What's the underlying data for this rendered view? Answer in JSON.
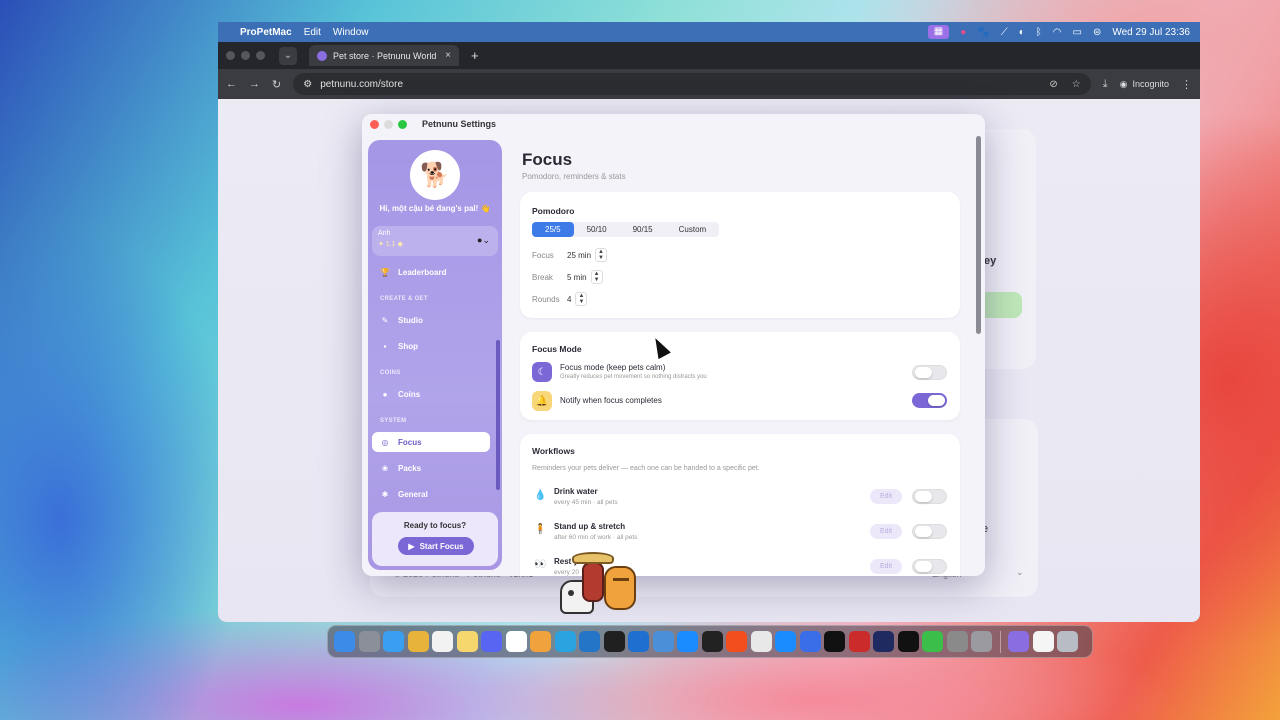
{
  "menubar": {
    "app_name": "ProPetMac",
    "menus": [
      "Edit",
      "Window"
    ],
    "datetime": "Wed 29 Jul  23:36"
  },
  "browser": {
    "tab_title": "Pet store · Petnunu World",
    "url": "petnunu.com/store",
    "incognito_label": "Incognito"
  },
  "background_page": {
    "partial_text_1": "ey",
    "partial_btn": "nd",
    "partial_text_2": "e",
    "footer_left": "© 2026 Petnunu · Petnuno · v1.0.1",
    "footer_lang": "English"
  },
  "settings": {
    "window_title": "Petnunu Settings",
    "sidebar": {
      "greeting": "Hi, một cậu bé đang's pal! 👋",
      "user_name": "Anh",
      "user_stats": "✦ 1.1 ◆",
      "items": {
        "leaderboard": "Leaderboard",
        "section_create": "CREATE & GET",
        "studio": "Studio",
        "shop": "Shop",
        "section_coins": "COINS",
        "coins": "Coins",
        "section_system": "SYSTEM",
        "focus": "Focus",
        "packs": "Packs",
        "general": "General"
      },
      "cta": {
        "question": "Ready to focus?",
        "button": "Start Focus"
      }
    },
    "page": {
      "title": "Focus",
      "subtitle": "Pomodoro, reminders & stats"
    },
    "pomodoro": {
      "header": "Pomodoro",
      "presets": [
        "25/5",
        "50/10",
        "90/15",
        "Custom"
      ],
      "selected_preset": "25/5",
      "focus_label": "Focus",
      "focus_value": "25 min",
      "break_label": "Break",
      "break_value": "5 min",
      "rounds_label": "Rounds",
      "rounds_value": "4"
    },
    "focus_mode": {
      "header": "Focus Mode",
      "mode_title": "Focus mode (keep pets calm)",
      "mode_desc": "Greatly reduces pet movement so nothing distracts you",
      "mode_enabled": false,
      "notify_title": "Notify when focus completes",
      "notify_enabled": true
    },
    "workflows": {
      "header": "Workflows",
      "desc": "Reminders your pets deliver — each one can be handed to a specific pet.",
      "edit_label": "Edit",
      "items": [
        {
          "title": "Drink water",
          "desc": "every 45 min · all pets",
          "icon": "water-drop-icon",
          "enabled": false
        },
        {
          "title": "Stand up & stretch",
          "desc": "after 60 min of work · all pets",
          "icon": "stretch-icon",
          "enabled": false
        },
        {
          "title": "Rest your e",
          "desc": "every 20",
          "icon": "eyes-icon",
          "enabled": false
        }
      ]
    }
  },
  "dock": {
    "apps": [
      "Finder",
      "Launchpad",
      "Safari",
      "Chrome",
      "Calendar",
      "Notes",
      "Discord",
      "Zalo",
      "Pages",
      "Telegram",
      "VS Code",
      "Cursor",
      "Xcode",
      "Files",
      "App Store",
      "Terminal",
      "Figma",
      "Proxyman",
      "App Store 2",
      "Shortcuts",
      "Stocks",
      "Remote",
      "Warp",
      "iTerm",
      "Activity",
      "Utilities",
      "Settings",
      "Petnunu",
      "Preview",
      "Trash"
    ]
  },
  "colors": {
    "accent": "#7c67d6",
    "segment_selected": "#3d7be8",
    "sidebar": "#a596e6"
  }
}
